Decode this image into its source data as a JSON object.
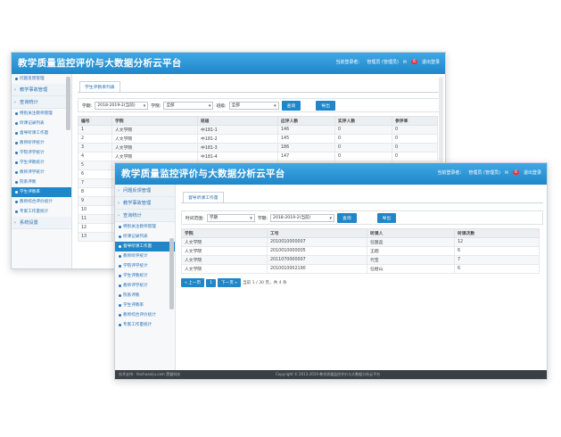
{
  "app_title": "教学质量监控评价与大数据分析云平台",
  "header": {
    "current_user": "当前登录者：",
    "user_name": "管理员 (管理员)",
    "badge": "6",
    "logout": "退出登录"
  },
  "back": {
    "sidebar": {
      "top_item": "问题反馈管理",
      "sections": [
        "教学事故管理",
        "查询统计"
      ],
      "items": [
        "特别关注教师管理",
        "听课记录列表",
        "督导听课工作量",
        "教师听评统计",
        "学院评学统计",
        "学生评教统计",
        "教师评学统计",
        "院系评教",
        "学生评教率",
        "教师综合评价统计",
        "专家工作量统计"
      ],
      "selected_index": 8,
      "bottom_section": "系统设置"
    },
    "tab": "学生评教率列表",
    "filter": {
      "label_term": "学期:",
      "term_value": "2018-2019-2(当前)",
      "label_college": "学院:",
      "college_value": "全部",
      "label_class": "班级:",
      "class_value": "全部",
      "query": "查询",
      "back": "导出"
    },
    "table": {
      "headers": [
        "编号",
        "学院",
        "班级",
        "应评人数",
        "实评人数",
        "参评率"
      ],
      "rows": [
        [
          "1",
          "人文学院",
          "中181-1",
          "146",
          "0",
          "0"
        ],
        [
          "2",
          "人文学院",
          "中181-2",
          "145",
          "0",
          "0"
        ],
        [
          "3",
          "人文学院",
          "中181-3",
          "186",
          "0",
          "0"
        ],
        [
          "4",
          "人文学院",
          "中181-4",
          "147",
          "0",
          "0"
        ],
        [
          "5",
          "",
          "",
          "",
          "",
          ""
        ],
        [
          "6",
          "",
          "",
          "",
          "",
          ""
        ],
        [
          "7",
          "",
          "",
          "",
          "",
          ""
        ],
        [
          "8",
          "",
          "",
          "",
          "",
          ""
        ],
        [
          "9",
          "",
          "",
          "",
          "",
          ""
        ],
        [
          "10",
          "",
          "",
          "",
          "",
          ""
        ],
        [
          "11",
          "",
          "",
          "",
          "",
          ""
        ],
        [
          "12",
          "",
          "",
          "",
          "",
          ""
        ],
        [
          "13",
          "",
          "",
          "",
          "",
          ""
        ]
      ]
    }
  },
  "front": {
    "sidebar": {
      "sections": [
        "问题反馈管理",
        "教学事故管理",
        "查询统计"
      ],
      "items": [
        "特别关注教师管理",
        "听课记录列表",
        "督导听课工作量",
        "教师听评统计",
        "学院评学统计",
        "学生评教统计",
        "教师评学统计",
        "院系评教",
        "学生评教率",
        "教师综合评价统计",
        "专家工作量统计"
      ],
      "selected_index": 2
    },
    "tab": "督导听课工作量",
    "filter": {
      "label_range": "时间范围:",
      "range_value": "学期",
      "label_term": "学期:",
      "term_value": "2018-2019-2(当前)",
      "query": "查询",
      "export": "导出"
    },
    "table": {
      "headers": [
        "学院",
        "工号",
        "听课人",
        "听课次数"
      ],
      "rows": [
        [
          "人文学院",
          "2010010000007",
          "任国品",
          "12"
        ],
        [
          "人文学院",
          "2010010000005",
          "王翔",
          "6"
        ],
        [
          "人文学院",
          "2011070000007",
          "代宝",
          "7"
        ],
        [
          "人文学院",
          "2010010002190",
          "任继山",
          "6"
        ]
      ]
    },
    "pager": {
      "prev": "« 上一页",
      "page": "1",
      "next": "下一页 »",
      "info": "当前  1  / 30  页，共 4 条"
    },
    "footer": {
      "left": "技术支持：feichuanjiu.com  黑猫科技",
      "center": "Copyright © 2013-2019  教学质量监控评价与大数据分析云平台"
    }
  }
}
